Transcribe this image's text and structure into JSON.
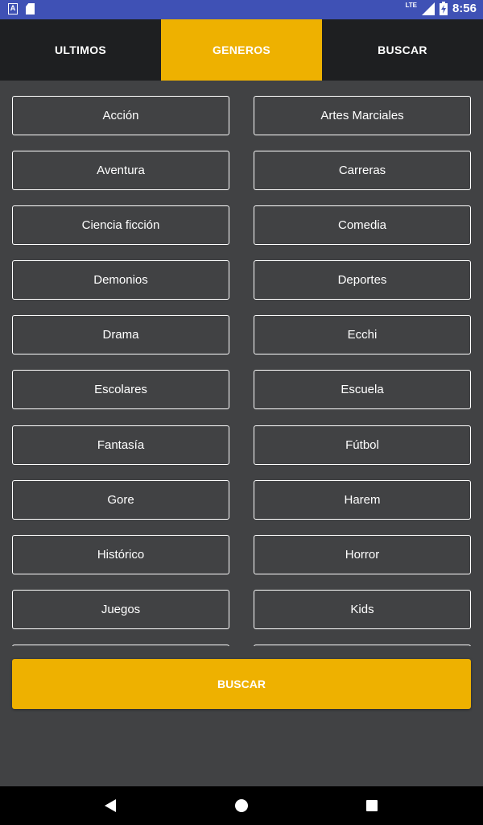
{
  "status_bar": {
    "left_icons": [
      "notification-a-icon",
      "sd-card-icon"
    ],
    "network": "LTE",
    "time": "8:56"
  },
  "tabs": [
    {
      "label": "ULTIMOS",
      "active": false
    },
    {
      "label": "GENEROS",
      "active": true
    },
    {
      "label": "BUSCAR",
      "active": false
    }
  ],
  "genres": [
    "Acción",
    "Artes Marciales",
    "Aventura",
    "Carreras",
    "Ciencia ficción",
    "Comedia",
    "Demonios",
    "Deportes",
    "Drama",
    "Ecchi",
    "Escolares",
    "Escuela",
    "Fantasía",
    "Fútbol",
    "Gore",
    "Harem",
    "Histórico",
    "Horror",
    "Juegos",
    "Kids"
  ],
  "search_button": {
    "label": "BUSCAR"
  },
  "colors": {
    "accent": "#eeb100",
    "background": "#414244",
    "tabbar": "#1e1f21",
    "status_bar": "#3f51b5"
  },
  "nav_icons": [
    "back-icon",
    "home-icon",
    "recents-icon"
  ]
}
